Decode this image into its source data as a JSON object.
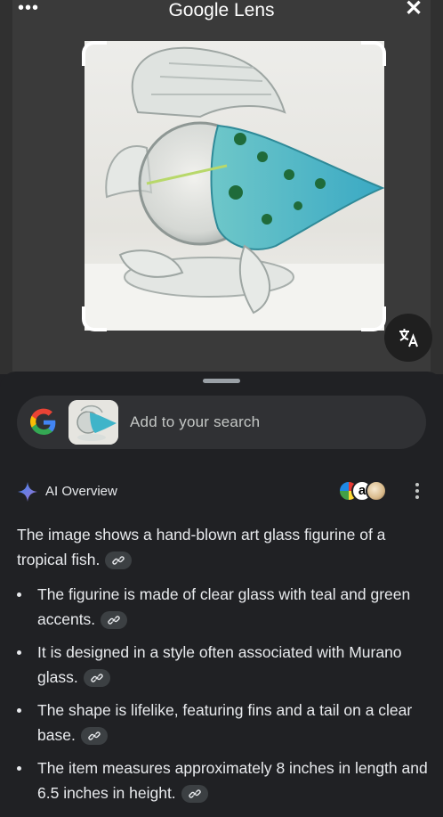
{
  "app": {
    "title": "Google Lens"
  },
  "icons": {
    "more": "more-horizontal-icon",
    "close": "close-icon",
    "translate": "translate-icon",
    "google": "google-logo-icon",
    "sparkle": "sparkle-icon",
    "kebab": "more-vertical-icon",
    "link": "link-icon"
  },
  "search": {
    "placeholder": "Add to your search"
  },
  "ai_overview": {
    "title": "AI Overview",
    "summary": "The image shows a hand-blown art glass figurine of a tropical fish.",
    "bullets": [
      "The figurine is made of clear glass with teal and green accents.",
      "It is designed in a style often associated with Murano glass.",
      "The shape is lifelike, featuring fins and a tail on a clear base.",
      "The item measures approximately 8 inches in length and 6.5 inches in height."
    ]
  },
  "colors": {
    "background": "#202124",
    "searchbar": "#303134",
    "accent_blue": "#4285f4",
    "teal": "#3fb4c9"
  }
}
